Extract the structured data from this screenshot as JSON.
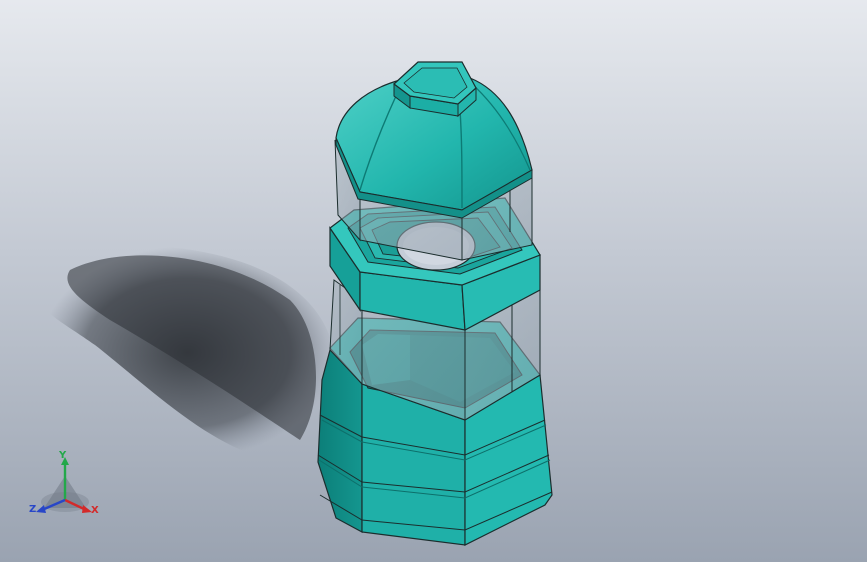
{
  "app": {
    "window_title": ""
  },
  "model": {
    "name": "",
    "colors": {
      "body": "#21b5ad",
      "body_dark": "#0f8a84",
      "body_light": "#5fd6ce",
      "outline": "#1b2d2d",
      "glass": "#7fa7aa",
      "background_top": "#e6e9ee",
      "background_bottom": "#9aa3b1"
    }
  },
  "triad": {
    "x_label": "X",
    "y_label": "Y",
    "z_label": "Z",
    "x_color": "#d32a2a",
    "y_color": "#23a84a",
    "z_color": "#2846c8"
  }
}
